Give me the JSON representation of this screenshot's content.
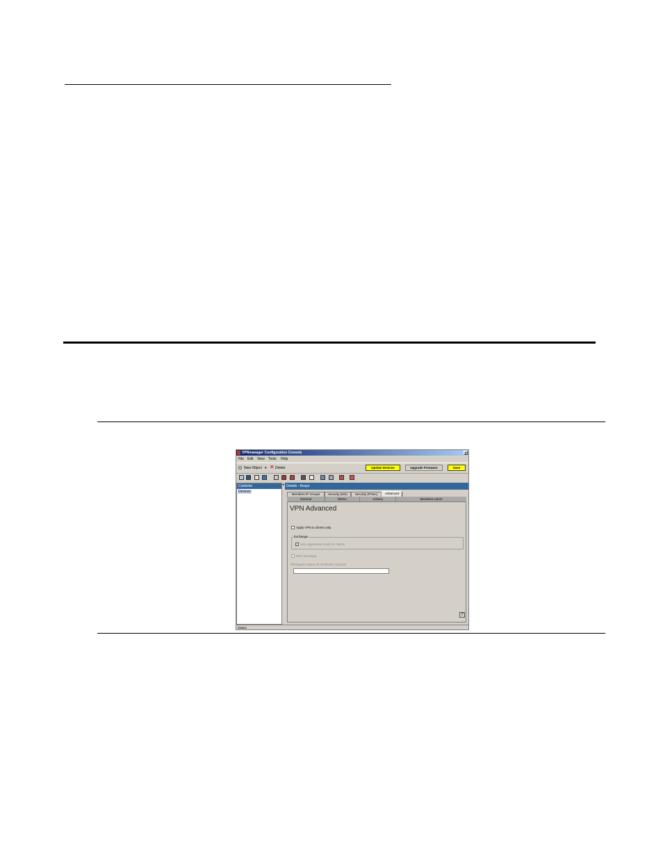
{
  "app": {
    "title": "VPNmanager Configuration Console",
    "close_glyph": "×",
    "menu": [
      "File",
      "Edit",
      "View",
      "Tools",
      "Help"
    ],
    "toolbar": {
      "new_object_label": "New Object",
      "dropdown_glyph": "▾",
      "delete_glyph": "✕",
      "delete_label": "Delete",
      "update_devices_label": "Update Devices",
      "upgrade_firmware_label": "Upgrade Firmware",
      "save_label": "Save",
      "highlight_color": "#ffff00"
    },
    "left_panel": {
      "header": "Contents",
      "items": [
        "Devices"
      ]
    },
    "splitter_glyph": "◂",
    "details": {
      "header": "Details - Avaya",
      "tabs_row1": [
        "Members-IP Groups",
        "Security (IKE)",
        "Security (IPSec)",
        "Advanced"
      ],
      "active_tab": "Advanced",
      "tabs_row2": [
        "General",
        "Memo",
        "Actions",
        "Members-Users"
      ],
      "heading": "VPN Advanced",
      "apply_vpn_label": "Apply VPN to clients only",
      "exchange_label": "Exchange",
      "aggressive_mode_label": "Use Aggressive mode for clients",
      "check_glyph": "✓",
      "dpd_label": "DPD (Routing)",
      "dn_label": "Distinguish Name of Certificate Authority",
      "help_glyph": "?"
    },
    "status_text": "Status",
    "accent_color": "#336699"
  }
}
